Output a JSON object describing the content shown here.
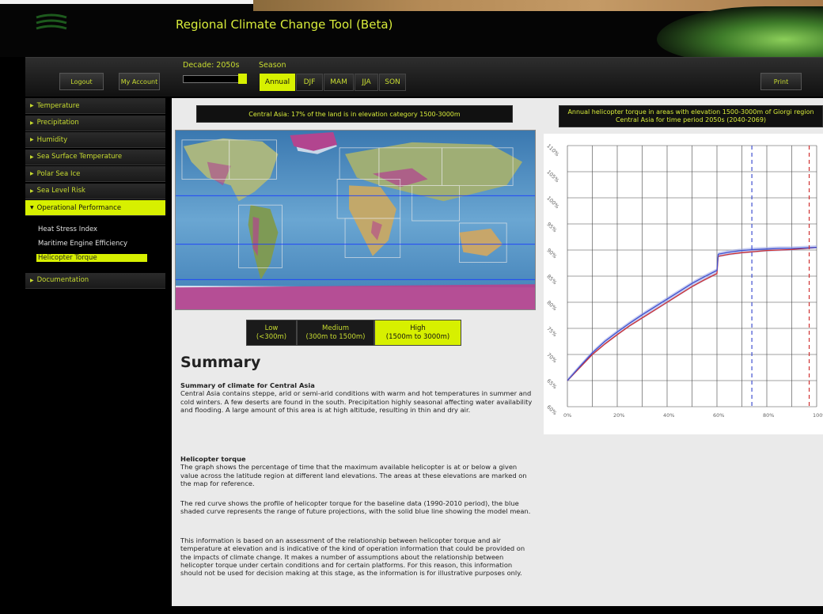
{
  "header": {
    "title": "Regional Climate Change Tool (Beta)"
  },
  "toolbar": {
    "logout_label": "Logout",
    "account_label": "My Account",
    "print_label": "Print",
    "decade_label": "Decade: 2050s",
    "decade_slider_fraction": 1.0,
    "season_label": "Season",
    "seasons": [
      "Annual",
      "DJF",
      "MAM",
      "JJA",
      "SON"
    ],
    "active_season": "Annual"
  },
  "sidebar": {
    "items": [
      {
        "label": "Temperature"
      },
      {
        "label": "Precipitation"
      },
      {
        "label": "Humidity"
      },
      {
        "label": "Sea Surface Temperature"
      },
      {
        "label": "Polar Sea Ice"
      },
      {
        "label": "Sea Level Risk"
      },
      {
        "label": "Operational Performance"
      }
    ],
    "sub_items": [
      {
        "label": "Heat Stress Index"
      },
      {
        "label": "Maritime Engine Efficiency"
      },
      {
        "label": "Helicopter Torque"
      }
    ],
    "documentation_label": "Documentation"
  },
  "main": {
    "map_caption": "Central Asia: 17% of the land is in elevation category 1500-3000m",
    "elevation": {
      "low_title": "Low",
      "low_range": "(<300m)",
      "mid_title": "Medium",
      "mid_range": "(300m to 1500m)",
      "high_title": "High",
      "high_range": "(1500m to 3000m)"
    },
    "summary_heading": "Summary",
    "climate_title": "Summary of climate for Central Asia",
    "climate_text": "Central Asia contains steppe, arid or semi-arid conditions with warm and hot temperatures in summer and cold winters. A few deserts are found in the south. Precipitation highly seasonal affecting water availability and flooding. A large amount of this area is at high altitude, resulting in thin and dry air.",
    "heli_title": "Helicopter torque",
    "heli_text1": "The graph shows the percentage of time that the maximum available helicopter is at or below a given value across the latitude region at different land elevations. The areas at these elevations are marked on the map for reference.",
    "heli_text2": "The red curve shows the profile of helicopter torque for the baseline data (1990-2010 period), the blue shaded curve represents the range of future projections, with the solid blue line showing the model mean.",
    "heli_text3": "This information is based on an assessment of the relationship between helicopter torque and air temperature at elevation and is indicative of the kind of operation information that could be provided on the impacts of climate change. It makes a number of assumptions about the relationship between helicopter torque under certain conditions and for certain platforms. For this reason, this information should not be used for decision making at this stage, as the information is for illustrative purposes only.",
    "chart_caption": "Annual helicopter torque in areas with elevation 1500-3000m of Giorgi region Central Asia for time period 2050s (2040-2069)"
  },
  "colors": {
    "accent": "#d7f000",
    "text_accent": "#c8dc30",
    "baseline": "#d03030",
    "projection": "#4050d0"
  },
  "chart_data": {
    "type": "line",
    "xlabel": "",
    "ylabel": "",
    "xlim": [
      0,
      100
    ],
    "ylim": [
      60,
      110
    ],
    "x_ticks": [
      "0%",
      "20%",
      "40%",
      "60%",
      "80%",
      "100%"
    ],
    "y_ticks": [
      "110%",
      "105%",
      "100%",
      "95%",
      "90%",
      "85%",
      "80%",
      "75%",
      "70%",
      "65%",
      "60%"
    ],
    "grid": true,
    "x": [
      0,
      5,
      10,
      15,
      20,
      25,
      30,
      35,
      40,
      45,
      50,
      55,
      60,
      60.5,
      65,
      70,
      75,
      80,
      85,
      90,
      95,
      100
    ],
    "series": [
      {
        "values": [
          65.0,
          67.5,
          70.0,
          72.0,
          73.8,
          75.5,
          77.0,
          78.5,
          80.0,
          81.5,
          83.0,
          84.3,
          85.5,
          88.8,
          89.2,
          89.5,
          89.7,
          89.9,
          90.0,
          90.1,
          90.3,
          90.5
        ]
      },
      {
        "values": [
          65.0,
          67.7,
          70.3,
          72.5,
          74.3,
          76.0,
          77.6,
          79.1,
          80.6,
          82.1,
          83.6,
          84.9,
          86.1,
          89.2,
          89.6,
          89.9,
          90.1,
          90.2,
          90.3,
          90.3,
          90.4,
          90.5
        ]
      }
    ],
    "vlines": [
      {
        "x": 74
      },
      {
        "x": 97
      }
    ]
  }
}
